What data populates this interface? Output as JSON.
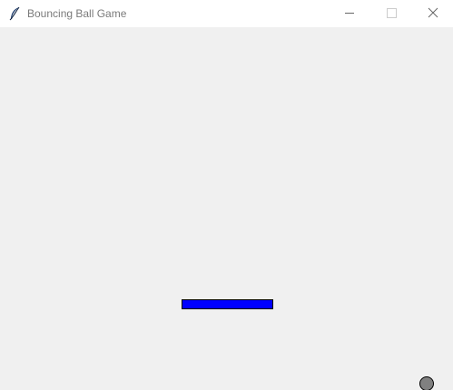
{
  "window": {
    "title": "Bouncing Ball Game",
    "icon": "feather-icon",
    "controls": [
      "minimize-icon",
      "maximize-icon",
      "close-icon"
    ]
  },
  "game": {
    "paddle_color": "#0000ff",
    "ball_color": "#808080",
    "background_color": "#f0f0f0"
  }
}
